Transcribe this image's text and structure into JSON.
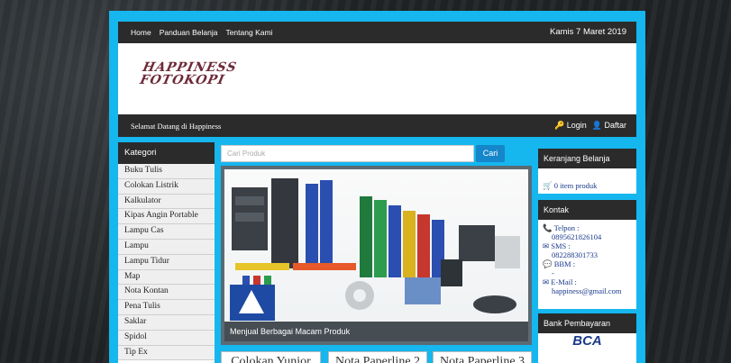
{
  "topnav": {
    "links": [
      "Home",
      "Panduan Belanja",
      "Tentang Kami"
    ],
    "date": "Kamis 7 Maret 2019"
  },
  "logo": {
    "line1": "HAPPINESS",
    "line2": "FOTOKOPI"
  },
  "subbar": {
    "welcome": "Selamat Datang di Happiness",
    "login": "Login",
    "register": "Daftar"
  },
  "categories": {
    "title": "Kategori",
    "items": [
      "Buku Tulis",
      "Colokan Listrik",
      "Kalkulator",
      "Kipas Angin Portable",
      "Lampu Cas",
      "Lampu",
      "Lampu Tidur",
      "Map",
      "Nota Kontan",
      "Pena Tulis",
      "Saklar",
      "Spidol",
      "Tip Ex"
    ]
  },
  "search": {
    "placeholder": "Cari Produk",
    "button": "Cari"
  },
  "banner": {
    "caption": "Menjual Berbagai Macam Produk",
    "brand_text": "Double A"
  },
  "products": [
    "Colokan Yunior",
    "Nota Paperline 2",
    "Nota Paperline 3"
  ],
  "cart": {
    "title": "Keranjang Belanja",
    "text": "0 item produk"
  },
  "contact": {
    "title": "Kontak",
    "phone_label": "Telpon :",
    "phone": "0895621826104",
    "sms_label": "SMS :",
    "sms": "082288301733",
    "bbm_label": "BBM :",
    "bbm": "-",
    "email_label": "E-Mail :",
    "email": "happiness@gmail.com"
  },
  "bank": {
    "title": "Bank Pembayaran",
    "logo": "BCA"
  },
  "colors": {
    "accent": "#16b6ee",
    "dark": "#2b2b2b",
    "button": "#1486c9"
  }
}
